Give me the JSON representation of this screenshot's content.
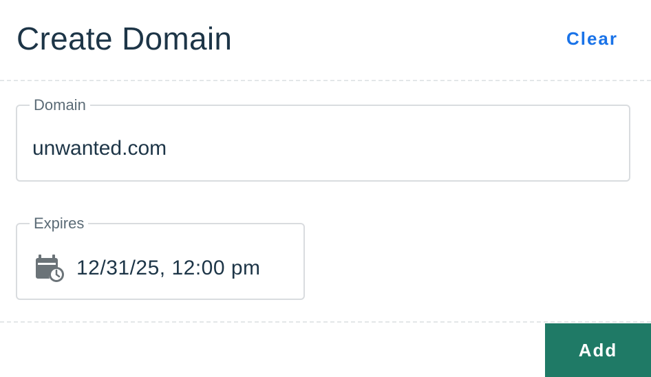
{
  "header": {
    "title": "Create Domain",
    "clear_label": "Clear"
  },
  "form": {
    "domain": {
      "label": "Domain",
      "value": "unwanted.com"
    },
    "expires": {
      "label": "Expires",
      "value": "12/31/25, 12:00 pm",
      "icon": "calendar-clock-icon"
    }
  },
  "footer": {
    "add_label": "Add"
  },
  "colors": {
    "accent_link": "#1a73e8",
    "primary_button": "#1f7a66",
    "text": "#1d3547",
    "border": "#d9dcdf"
  }
}
